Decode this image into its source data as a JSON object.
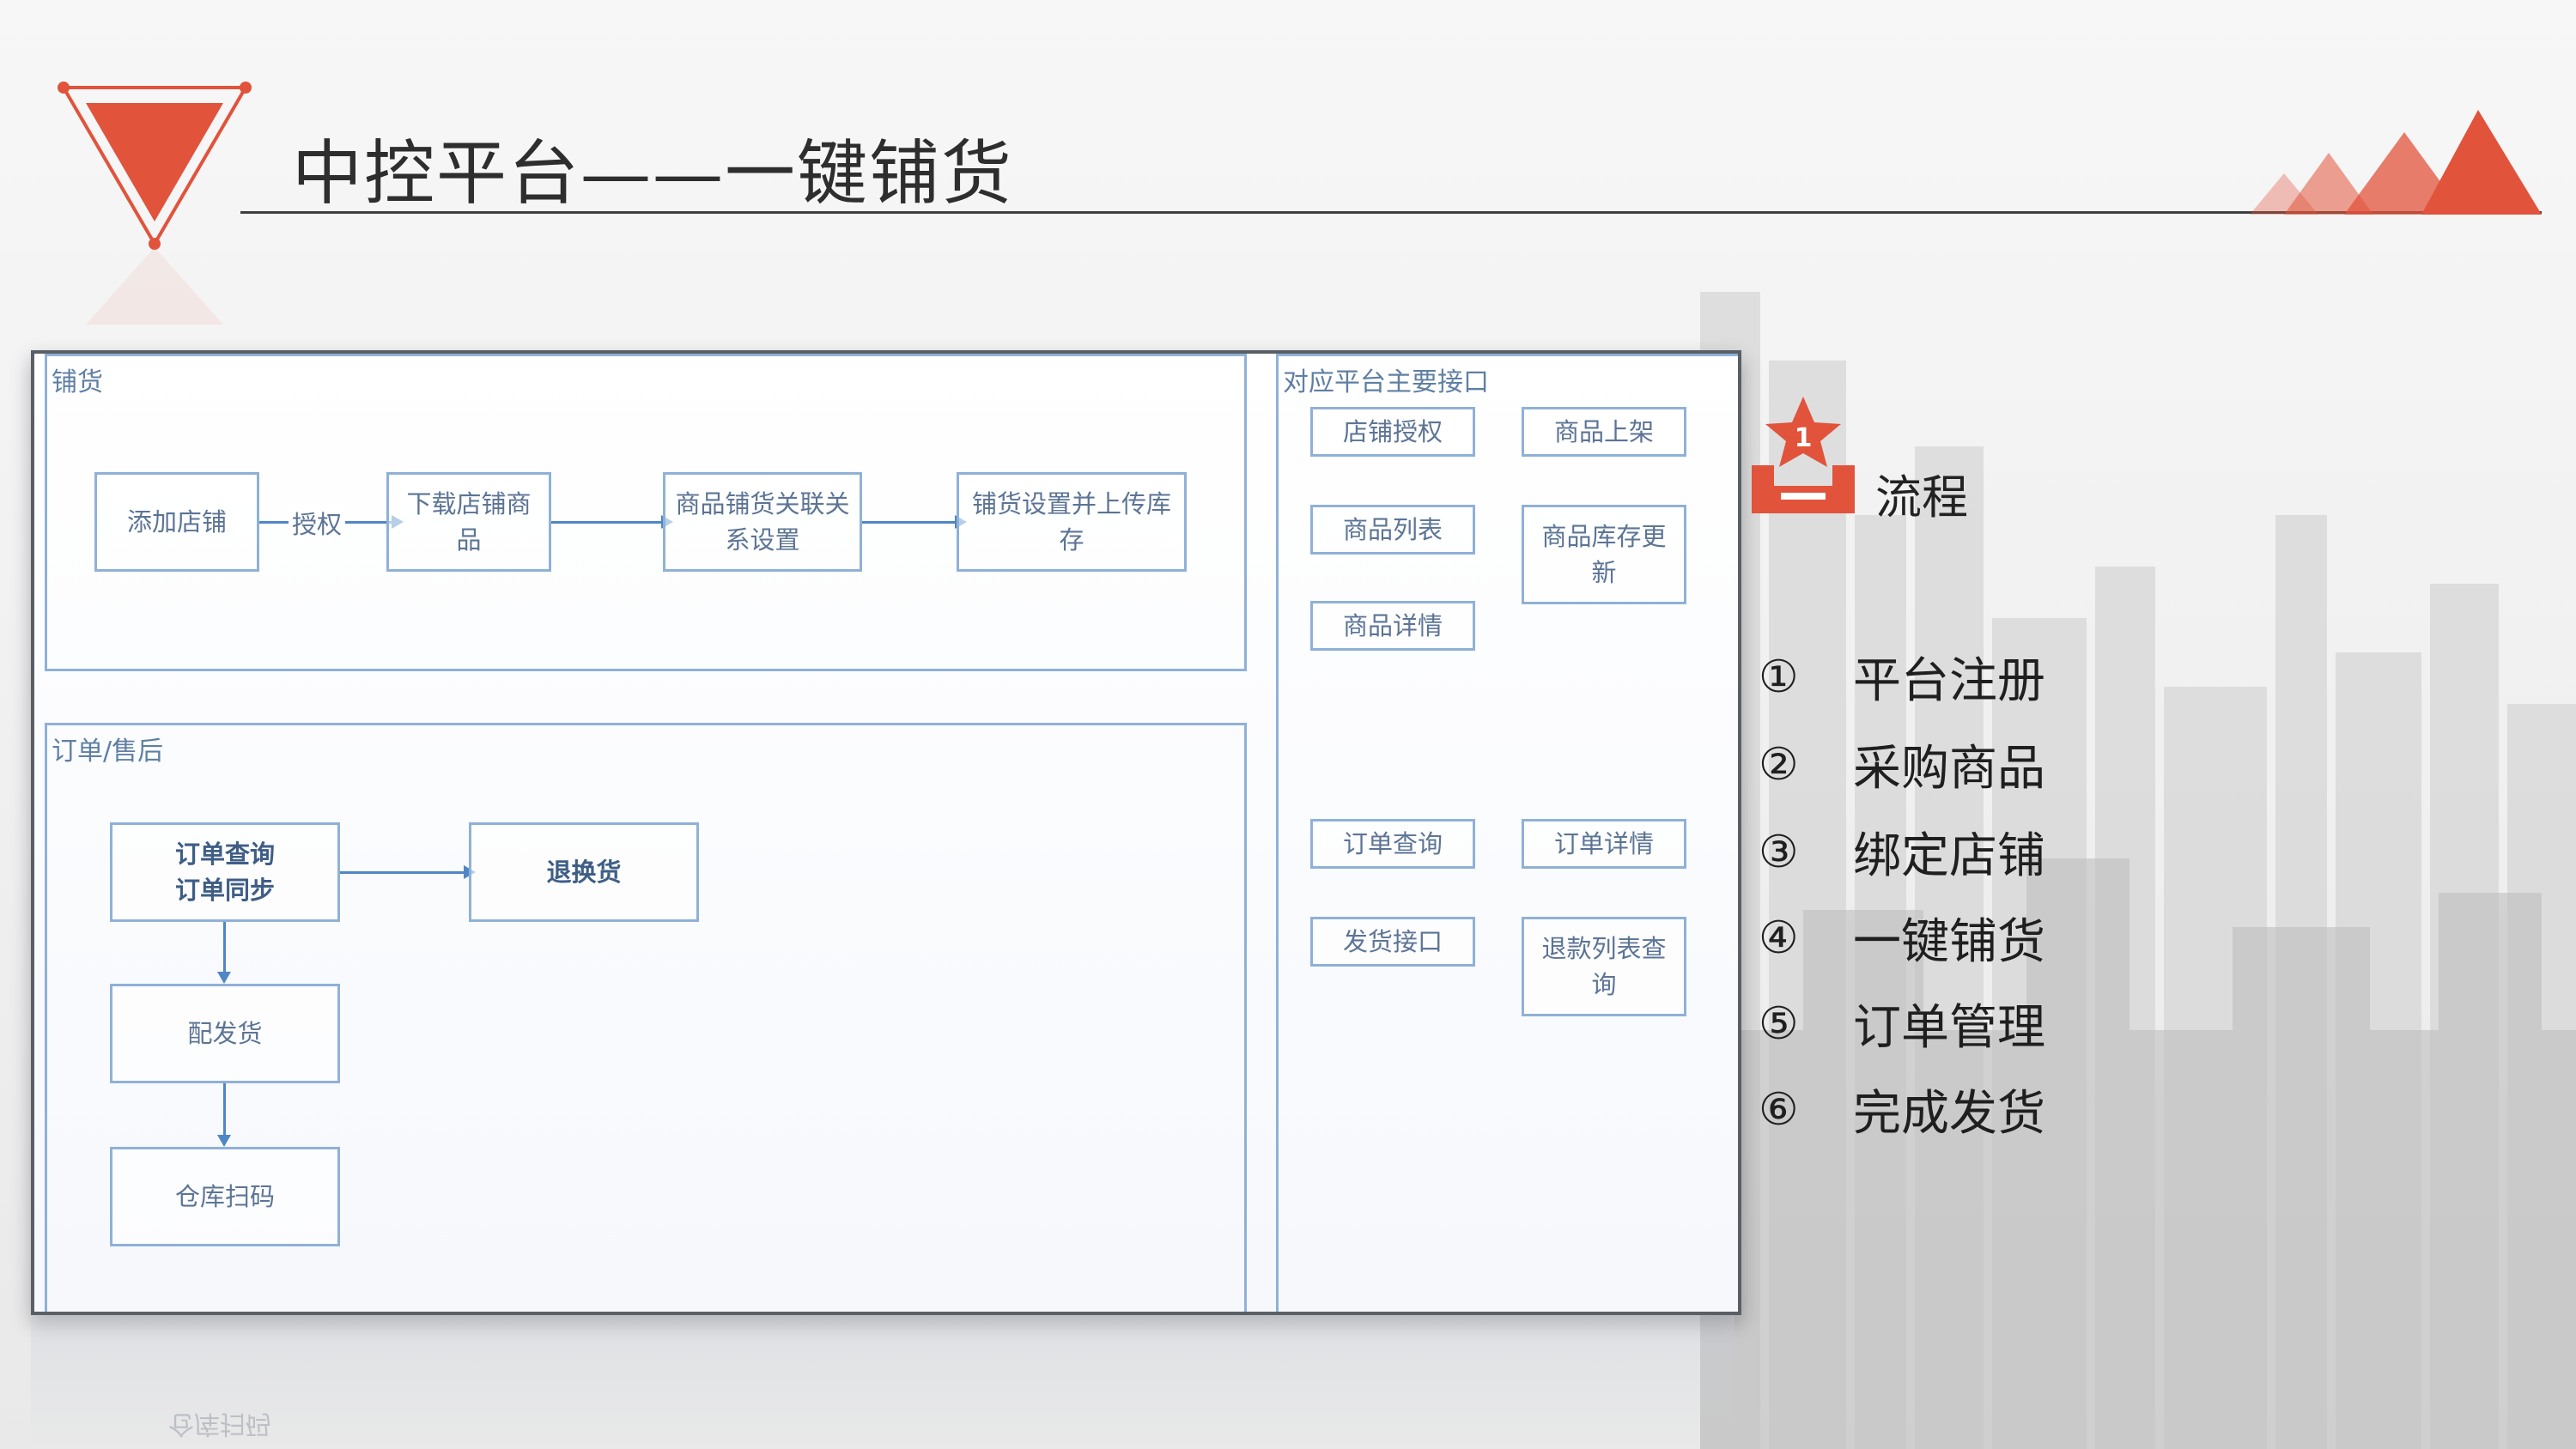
{
  "slide": {
    "title": "中控平台——一键铺货",
    "accent_color": "#e1533b"
  },
  "diagram": {
    "lane_pu": {
      "label": "铺货"
    },
    "lane_order": {
      "label": "订单/售后"
    },
    "lane_api": {
      "label": "对应平台主要接口"
    },
    "pu_nodes": [
      "添加店铺",
      "下载店铺商品",
      "商品铺货关联关系设置",
      "铺货设置并上传库存"
    ],
    "pu_edge_label": "授权",
    "order_nodes": {
      "query": "订单查询\n订单同步",
      "return": "退换货",
      "ship": "配发货",
      "scan": "仓库扫码"
    },
    "api_nodes": {
      "shop_auth": "店铺授权",
      "goods_up": "商品上架",
      "goods_list": "商品列表",
      "stock_update": "商品库存更新",
      "goods_detail": "商品详情",
      "order_query": "订单查询",
      "order_detail": "订单详情",
      "ship_api": "发货接口",
      "refund_query": "退款列表查询"
    }
  },
  "process": {
    "badge_number": "1",
    "title": "流程",
    "steps": [
      {
        "num": "①",
        "label": "平台注册"
      },
      {
        "num": "②",
        "label": "采购商品"
      },
      {
        "num": "③",
        "label": "绑定店铺"
      },
      {
        "num": "④",
        "label": "一键铺货"
      },
      {
        "num": "⑤",
        "label": "订单管理"
      },
      {
        "num": "⑥",
        "label": "完成发货"
      }
    ]
  },
  "icons": [
    "triangle-logo-icon",
    "mountain-peaks-icon",
    "ranked-star-tray-icon"
  ]
}
